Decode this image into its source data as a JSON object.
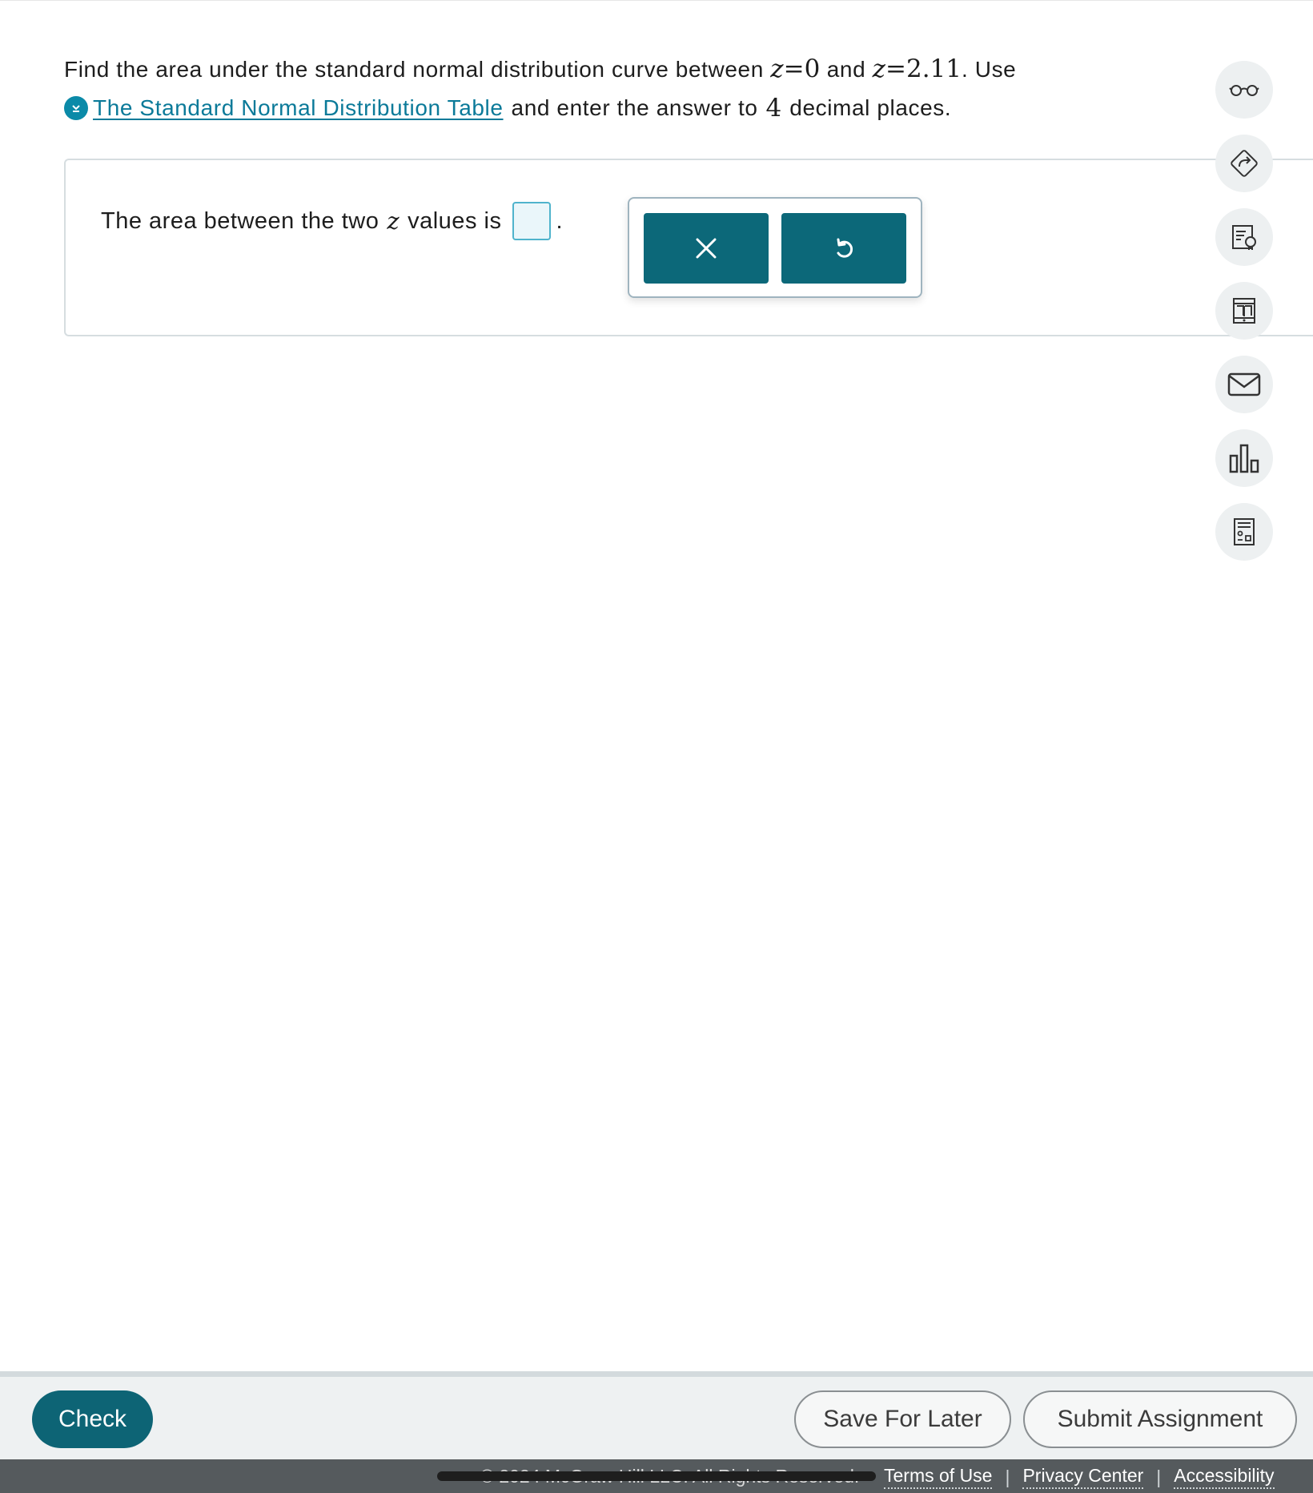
{
  "question": {
    "intro": "Find the area under the standard normal distribution curve between",
    "z_var": "z",
    "eq": "=",
    "z1": "0",
    "and": "and",
    "z2": "2.11",
    "use": ". Use",
    "link_text": "The Standard Normal Distribution Table",
    "suffix": "and enter the answer to",
    "places_number": "4",
    "places_text": "decimal places."
  },
  "answer": {
    "prefix": "The area between the two",
    "z_var": "z",
    "suffix": "values is",
    "value": "",
    "period": "."
  },
  "tools": {
    "clear_icon": "close-icon",
    "undo_icon": "undo-icon"
  },
  "side_rail": {
    "icons": [
      "glasses-icon",
      "directions-icon",
      "hint-icon",
      "ebook-icon",
      "mail-icon",
      "stats-icon",
      "calculator-icon"
    ]
  },
  "bottom_bar": {
    "check_label": "Check",
    "save_label": "Save For Later",
    "submit_label": "Submit Assignment"
  },
  "footer": {
    "copyright": "© 2024 McGraw Hill LLC. All Rights Reserved.",
    "terms": "Terms of Use",
    "privacy": "Privacy Center",
    "accessibility": "Accessibility",
    "separator": "|"
  },
  "colors": {
    "primary": "#0c6879",
    "link": "#0b7a99",
    "input_border": "#4fb3cc",
    "rail_bg": "#edf0f1"
  }
}
